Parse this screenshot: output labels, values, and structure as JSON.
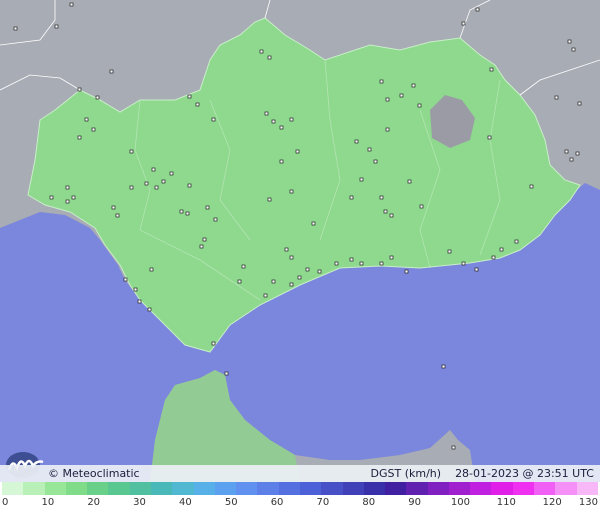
{
  "credit": {
    "copyright": "© Meteoclimatic",
    "variable": "DGST (km/h)",
    "timestamp": "28-01-2023 @ 23:51 UTC"
  },
  "colors": {
    "sea": "#7b86dd",
    "land_outside": "#a8acb4",
    "andalusia": "#8ed98e",
    "mountain_gray": "#9b9ba5"
  },
  "scale": {
    "ticks": [
      "0",
      "10",
      "20",
      "30",
      "40",
      "50",
      "60",
      "70",
      "80",
      "90",
      "100",
      "110",
      "120",
      "130"
    ],
    "colors": [
      "#d6f7d6",
      "#b8f0b8",
      "#98e698",
      "#80dc88",
      "#68d088",
      "#58c890",
      "#50c0a0",
      "#48b8b8",
      "#50b8d0",
      "#58b0e8",
      "#5ca0f0",
      "#6090f0",
      "#5c80e8",
      "#5470e0",
      "#4c60d8",
      "#4850c8",
      "#4040b8",
      "#3830a8",
      "#4020a0",
      "#6020b0",
      "#8020c0",
      "#a020d0",
      "#c020e0",
      "#e020e8",
      "#f030f0",
      "#f060f4",
      "#f490f6",
      "#f8b8f8"
    ]
  }
}
